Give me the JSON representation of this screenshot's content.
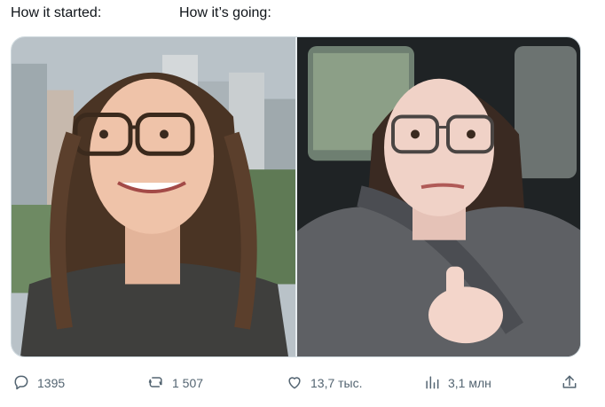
{
  "post": {
    "caption_left": "How it started:",
    "caption_right": "How it’s going:"
  },
  "actions": {
    "reply_count": "1395",
    "repost_count": "1 507",
    "like_count": "13,7 тыс.",
    "views_count": "3,1 млн"
  },
  "icons": {
    "reply": "reply-icon",
    "repost": "repost-icon",
    "like": "like-icon",
    "views": "views-icon",
    "share": "share-icon"
  }
}
